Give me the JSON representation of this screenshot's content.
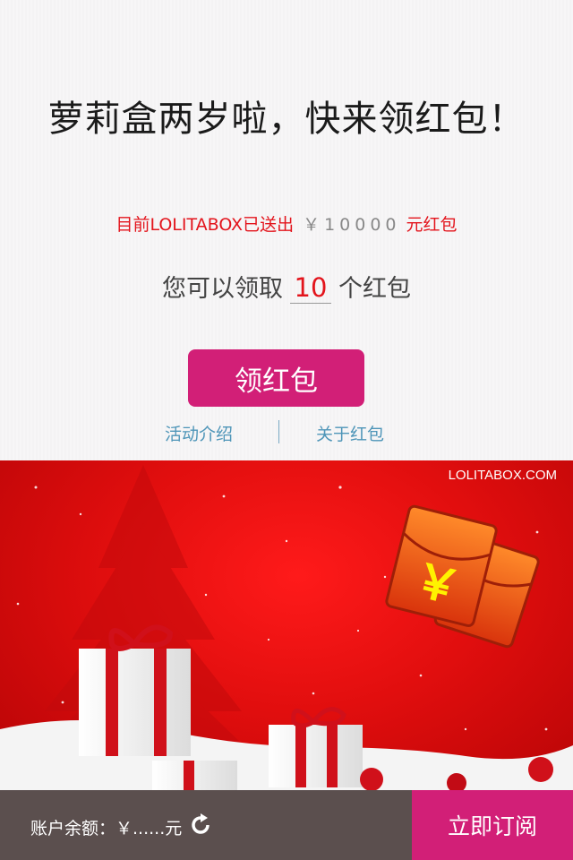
{
  "header": {
    "headline": "萝莉盒两岁啦，快来领红包！"
  },
  "stats": {
    "sent_prefix": "目前LOLITABOX已送出",
    "sent_amount": "￥10000",
    "sent_suffix": "元红包"
  },
  "claim": {
    "prefix": "您可以领取",
    "count": "10",
    "suffix": "个红包"
  },
  "buttons": {
    "claim_label": "领红包",
    "subscribe_label": "立即订阅"
  },
  "links": {
    "activity_intro": "活动介绍",
    "about_red_packet": "关于红包"
  },
  "banner": {
    "brand": "LOLITABOX.COM",
    "red_packet_symbol": "￥",
    "colors": {
      "red": "#e10e0e",
      "gold": "#f5a623"
    }
  },
  "footer": {
    "balance_label": "账户余额：￥......元",
    "refresh_icon": "refresh-icon"
  },
  "colors": {
    "accent_pink": "#d21f77",
    "highlight_red": "#e3141c",
    "link_blue": "#4e95b8",
    "footer_bg": "#5b4f4e"
  }
}
